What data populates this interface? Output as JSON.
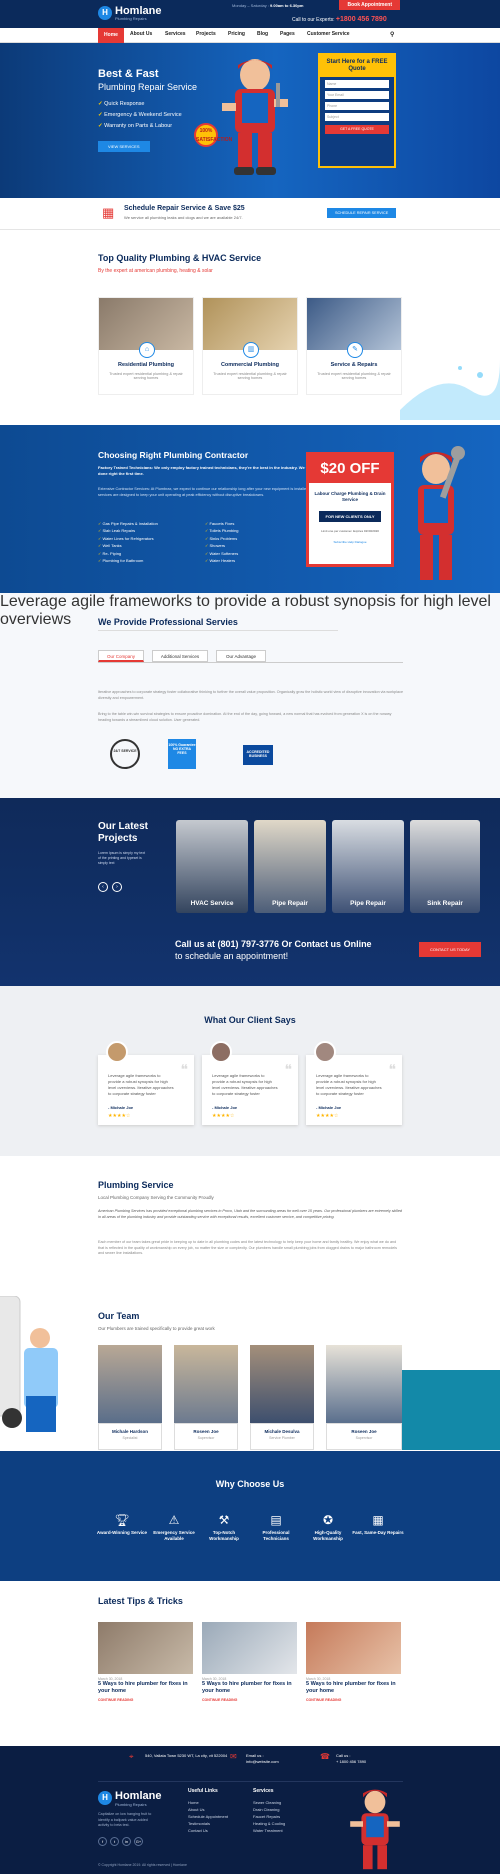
{
  "header": {
    "logo": "Homlane",
    "logo_sub": "Plumbing Repairs",
    "hours_label": "Monday – Saturday",
    "hours": "9.00am to 6.30pm",
    "book": "Book Appointment",
    "call_label": "Call to our Experts:",
    "call_number": "+1800 456 7890"
  },
  "nav": {
    "items": [
      "Home",
      "About Us",
      "Services",
      "Projects",
      "Pricing",
      "Blog",
      "Pages",
      "Customer Service"
    ]
  },
  "hero": {
    "title": "Best & Fast",
    "subtitle": "Plumbing Repair Service",
    "bullets": [
      "Quick Response",
      "Emergency & Weekend Service",
      "Warranty on Parts & Labour"
    ],
    "button": "VIEW SERVICES",
    "seal": "100% SATISFACTION",
    "quote": {
      "title": "Start Here for a FREE Quote",
      "fields": [
        "Name",
        "Your Email",
        "Phone",
        "Subject"
      ],
      "button": "GET A FREE QUOTE"
    }
  },
  "schedule": {
    "title": "Schedule Repair Service & Save $25",
    "sub": "We service all plumbing leaks and clogs and we are available 24/7.",
    "button": "SCHEDULE REPAIR SERVICE"
  },
  "services": {
    "title": "Top Quality Plumbing & HVAC Service",
    "sub": "By the expert at american plumbing, heating & solar",
    "cards": [
      {
        "title": "Residential Plumbing",
        "desc": "Trusted expert residential plumbing & repair serving homes"
      },
      {
        "title": "Commercial Plumbing",
        "desc": "Trusted expert residential plumbing & repair serving homes"
      },
      {
        "title": "Service & Repairs",
        "desc": "Trusted expert residential plumbing & repair serving homes"
      }
    ]
  },
  "choose": {
    "title": "Choosing Right Plumbing Contractor",
    "p1": "Factory Trained Technicians: We only employ factory trained technicians, they're the best in the industry. We work will be done right the first time.",
    "p2": "Extensive Contractor Services: At Plumbrax, we expect to continue our relationship long after your new equipment is installed. Our ongoing services are designed to keep your unit operating at peak efficiency without disruptive breakdowns.",
    "list_left": [
      "Gas Pipe Repairs & Installation",
      "Slab Leak Repairs",
      "Water Lines for Refrigerators",
      "Well Tanks",
      "Re- Piping",
      "Plumbing for Bathroom"
    ],
    "list_right": [
      "Faucets Fixes",
      "Toilets Plumbing",
      "Sinks Problems",
      "Showers",
      "Water Softeners",
      "Water Heaters"
    ],
    "offer": {
      "amount": "$20 OFF",
      "desc": "Labour Charge Plumbing & Drain Service",
      "tag": "FOR NEW CLIENTS ONLY",
      "note": "Limit one per customer. Expires 02/30/2020",
      "link": "Subscribe   Help Dialogue"
    }
  },
  "professional": {
    "title": "We Provide Professional Servies",
    "tabs": [
      "Our Company",
      "Additional Services",
      "Our Advantage"
    ],
    "lead": "Leverage agile frameworks to provide a robust synopsis for high level overviews",
    "para1": "Iterative approaches to corporate strategy foster collaborative thinking to further the overall value proposition. Organically grow the holistic world view of disruptive innovation via workplace diversity and empowerment.",
    "para2": "Bring to the table win-win survival strategies to ensure proactive domination. At the end of the day, going forward, a new normal that has evolved from generation X is on the runway heading towards a streamlined cloud solution. User generated.",
    "badges": [
      "24/7 SERVICE",
      "100% Guarantee NO EXTRA FEES",
      "ACCREDITED BUSINESS"
    ]
  },
  "projects": {
    "title": "Our Latest Projects",
    "desc": "Lorem Ipsum is simply my text of the printing and typeset is simply text",
    "items": [
      "HVAC Service",
      "Pipe Repair",
      "Pipe Repair",
      "Sink Repair"
    ],
    "call_text": "Call us at (801) 797-3776 Or Contact us Online",
    "call_sub": "to schedule an appointment!",
    "button": "CONTACT US TODAY"
  },
  "testimonials": {
    "title": "What Our Client Says",
    "items": [
      {
        "text": "Leverage agile frameworks to provide a robust synopsis for high level overviews. Iterative approaches to corporate strategy foster",
        "name": "- Michale Joe",
        "stars": "★★★★☆"
      },
      {
        "text": "Leverage agile frameworks to provide a robust synopsis for high level overviews. Iterative approaches to corporate strategy foster",
        "name": "- Michale Joe",
        "stars": "★★★★☆"
      },
      {
        "text": "Leverage agile frameworks to provide a robust synopsis for high level overviews. Iterative approaches to corporate strategy foster",
        "name": "- Michale Joe",
        "stars": "★★★★☆"
      }
    ]
  },
  "plumbing": {
    "title": "Plumbing Service",
    "sub": "Local Plumbing Company Serving the Community Proudly",
    "p1": "American Plumbing Services has provided exceptional plumbing services in Provo, Utah and the surrounding areas for well over 15 years. Our professional plumbers are extremely skilled in all areas of the plumbing industry and provide outstanding service with exceptional results, excellent customer service, and competitive pricing.",
    "p2": "Each member of our team takes great pride in keeping up to date in all plumbing codes and the latest technology to help keep your home and family healthy. We enjoy what we do and that is reflected in the quality of workmanship on every job, no matter the size or complexity. Our plumbers handle small plumbing jobs from clogged drains to major bathroom remodels and sewer line installations."
  },
  "team": {
    "title": "Our Team",
    "sub": "Our Plumbers are trained specifically to provide great work",
    "members": [
      {
        "name": "Michale Hardson",
        "role": "Specialist"
      },
      {
        "name": "Roseen Joe",
        "role": "Supervisor"
      },
      {
        "name": "Michale Desulva",
        "role": "Service Plumber"
      },
      {
        "name": "Roseen Joe",
        "role": "Supervisor"
      }
    ]
  },
  "why": {
    "title": "Why Choose Us",
    "items": [
      "Award-Winning Service",
      "Emergency Service Available",
      "Top-Notch Workmanship",
      "Professional Technicians",
      "High-Quality Workmanship",
      "Fast, Same-Day Repairs"
    ]
  },
  "tips": {
    "title": "Latest Tips & Tricks",
    "items": [
      {
        "date": "March 30, 2018",
        "title": "5 Ways to hire plumber for fixes in your home",
        "more": "CONTINUE READING"
      },
      {
        "date": "March 30, 2018",
        "title": "5 Ways to hire plumber for fixes in your home",
        "more": "CONTINUE READING"
      },
      {
        "date": "March 30, 2018",
        "title": "5 Ways to hire plumber for fixes in your home",
        "more": "CONTINUE READING"
      }
    ]
  },
  "footer": {
    "address": "540, Vallata Town 5230 WT, La city, vit 522004",
    "email_label": "Email us :",
    "email": "info@website.com",
    "call_label": "Call us :",
    "call": "+ 1800 456 7890",
    "about": "Capitalize on low hanging fruit to identify a ballpark value added activity to beta test.",
    "useful_title": "Useful Links",
    "useful": [
      "Home",
      "About Us",
      "Schedule Appointment",
      "Testimonials",
      "Contact Us"
    ],
    "services_title": "Services",
    "services": [
      "Sewer Cleaning",
      "Drain Cleaning",
      "Faucet Repairs",
      "Heating & Cooling",
      "Water Treatment"
    ],
    "copyright": "© Copyright Homlane 2019. All rights reserved | Homlane"
  }
}
